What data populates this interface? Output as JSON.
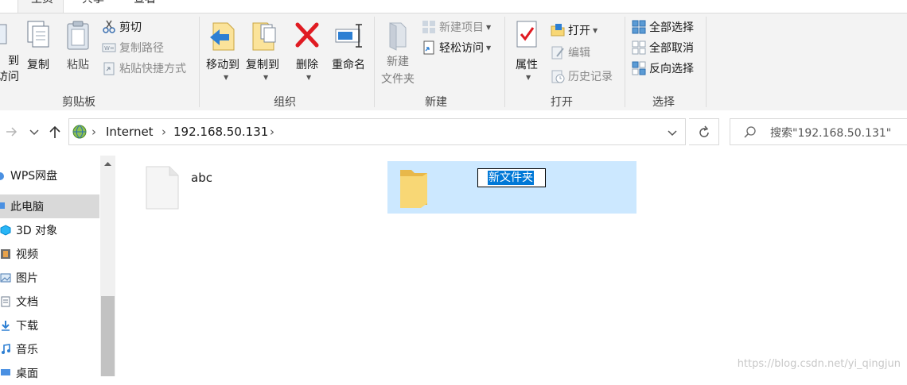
{
  "tabs": [
    {
      "label": "主页"
    },
    {
      "label": "共享"
    },
    {
      "label": "查看"
    }
  ],
  "ribbon": {
    "clipboard": {
      "pin_label": "固定到\n快速访问",
      "pin_label_visible": "到\n访问",
      "copy": "复制",
      "paste": "粘贴",
      "cut": "剪切",
      "copy_path": "复制路径",
      "paste_shortcut": "粘贴快捷方式",
      "group": "剪贴板"
    },
    "organize": {
      "move_to": "移动到",
      "copy_to": "复制到",
      "delete": "删除",
      "rename": "重命名",
      "group": "组织"
    },
    "new": {
      "new_folder_l1": "新建",
      "new_folder_l2": "文件夹",
      "new_item": "新建项目",
      "easy_access": "轻松访问",
      "group": "新建"
    },
    "open": {
      "properties": "属性",
      "open": "打开",
      "edit": "编辑",
      "history": "历史记录",
      "group": "打开"
    },
    "select": {
      "select_all": "全部选择",
      "select_none": "全部取消",
      "invert": "反向选择",
      "group": "选择"
    }
  },
  "address": {
    "crumbs": [
      "Internet",
      "192.168.50.131"
    ],
    "search_placeholder": "搜索\"192.168.50.131\""
  },
  "navpane": {
    "items": [
      {
        "label": "WPS网盘",
        "icon": "cloud-icon"
      },
      {
        "label": "此电脑",
        "icon": "computer-icon",
        "selected": true
      },
      {
        "label": "3D 对象",
        "icon": "cube-icon"
      },
      {
        "label": "视频",
        "icon": "film-icon"
      },
      {
        "label": "图片",
        "icon": "picture-icon"
      },
      {
        "label": "文档",
        "icon": "document-icon"
      },
      {
        "label": "下载",
        "icon": "download-icon"
      },
      {
        "label": "音乐",
        "icon": "music-icon"
      },
      {
        "label": "桌面",
        "icon": "desktop-icon"
      }
    ]
  },
  "content": {
    "file_name": "abc",
    "folder_rename_value": "新文件夹"
  },
  "watermark": "https://blog.csdn.net/yi_qingjun",
  "colors": {
    "ribbon_bg": "#f3f3f3",
    "selection_bg": "#cce8ff",
    "accent": "#0078d7",
    "folder": "#f8d775"
  }
}
